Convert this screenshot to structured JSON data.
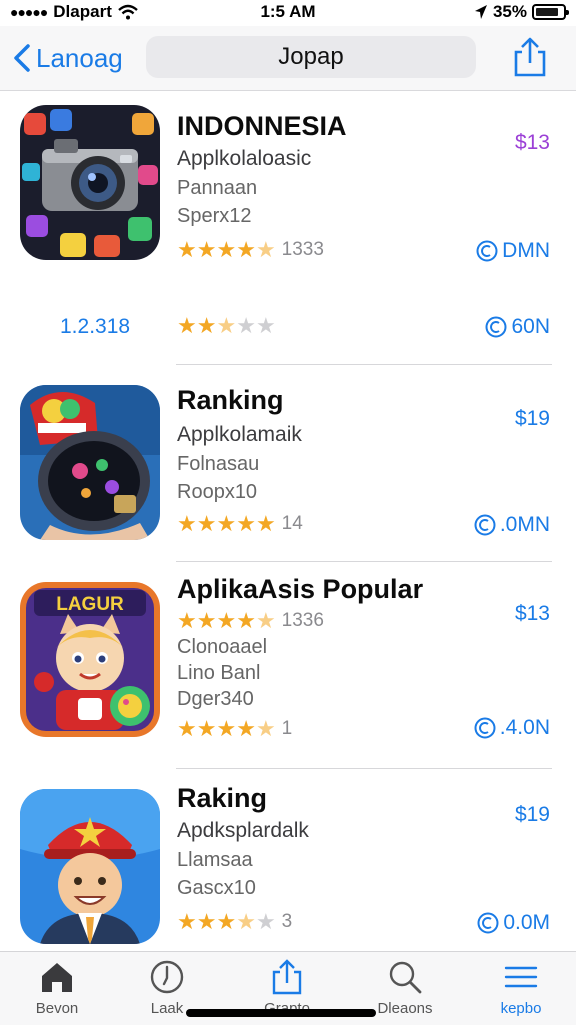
{
  "status": {
    "carrier": "Dlapart",
    "time": "1:5 AM",
    "battery": "35%",
    "battery_level": 0.74
  },
  "nav": {
    "back_label": "Lanoag",
    "title": "Jopap"
  },
  "rows": [
    {
      "name": "INDONNESIA",
      "subtitle": "Applkolaloasic",
      "line2": "Pannaan",
      "line3": "Sperx12",
      "stars": 4.5,
      "rating_count": "1333",
      "price": "$13",
      "get_label": "DMN",
      "extra_version": "1.2.318",
      "extra_stars": 2.5,
      "extra_get_label": "60N"
    },
    {
      "name": "Ranking",
      "subtitle": "Applkolamaik",
      "line2": "Folnasau",
      "line3": "Roopx10",
      "stars": 5,
      "rating_count": "14",
      "price": "$19",
      "get_label": ".0MN"
    },
    {
      "name": "AplikaAsis Popular",
      "subtitle_stars": 4.5,
      "subtitle_count": "1336",
      "line2": "Clonoaael",
      "line3": "Lino Banl",
      "line4": "Dger340",
      "stars": 4.5,
      "rating_count": "1",
      "price": "$13",
      "get_label": ".4.0N",
      "icon_text": "LAGUR"
    },
    {
      "name": "Raking",
      "subtitle": "Apdksplardalk",
      "line2": "Llamsaa",
      "line3": "Gascx10",
      "stars": 3.5,
      "rating_count": "3",
      "price": "$19",
      "get_label": "0.0M"
    }
  ],
  "tabs": [
    {
      "label": "Bevon",
      "icon": "house-icon"
    },
    {
      "label": "Laak",
      "icon": "clock-icon"
    },
    {
      "label": "Grapto",
      "icon": "share-icon"
    },
    {
      "label": "Dleaons",
      "icon": "search-icon"
    },
    {
      "label": "kepbo",
      "icon": "menu-icon",
      "active": true
    }
  ],
  "colors": {
    "accent": "#1a7be6",
    "star": "#f3a724",
    "price_purple": "#9b3fd6"
  }
}
